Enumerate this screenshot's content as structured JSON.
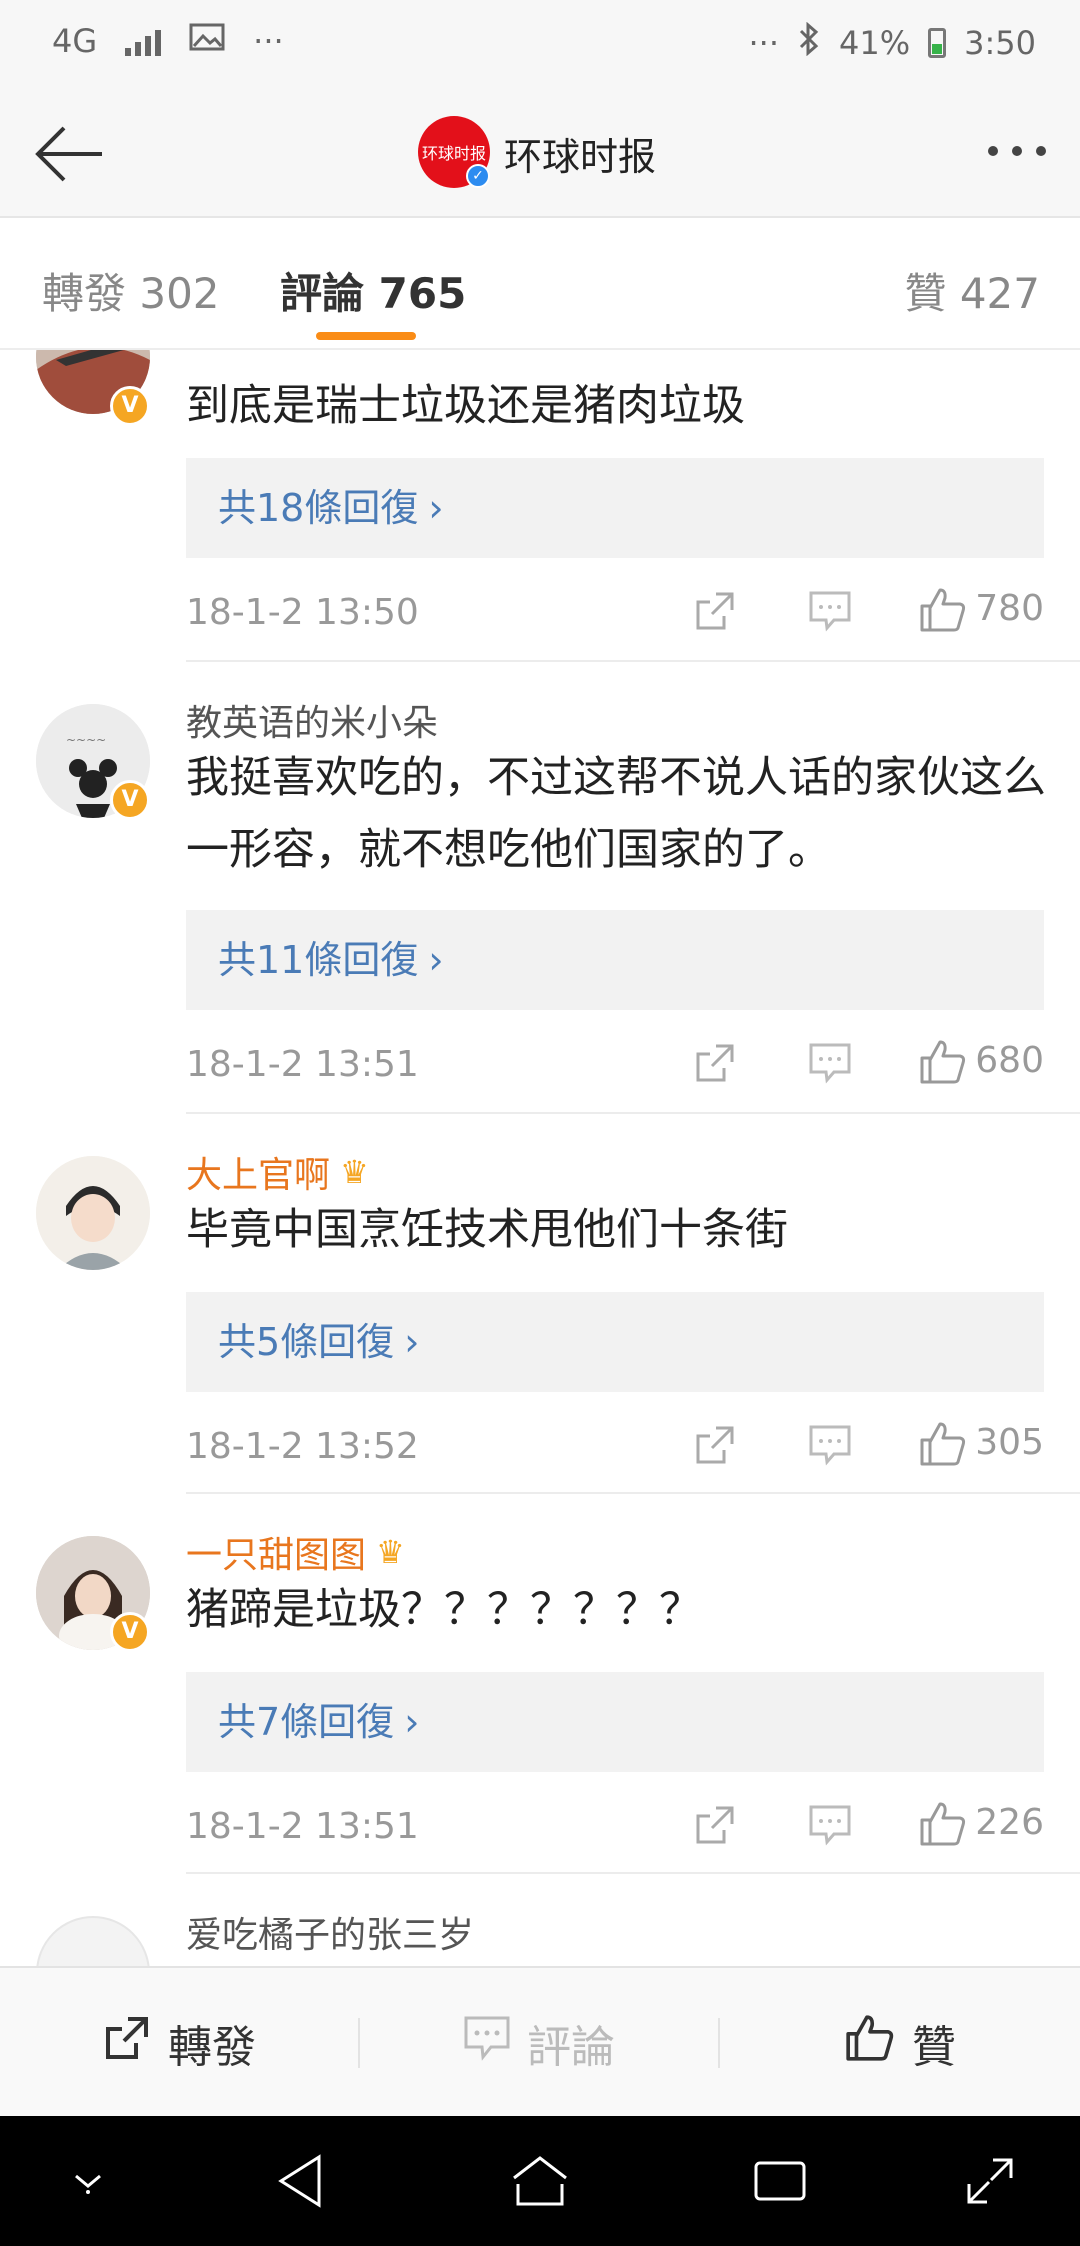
{
  "status_bar": {
    "network": "4G",
    "more_left": "···",
    "more_right": "···",
    "battery": "41%",
    "time": "3:50"
  },
  "nav": {
    "title": "环球时报",
    "logo_text": "环球时报"
  },
  "tabs": {
    "repost": "轉發 302",
    "comment": "評論 765",
    "like": "贊 427"
  },
  "comments": [
    {
      "name": "",
      "text": "到底是瑞士垃圾还是猪肉垃圾",
      "replies": "共18條回復",
      "time": "18-1-2 13:50",
      "likes": "780",
      "verified": true
    },
    {
      "name": "教英语的米小朵",
      "text": "我挺喜欢吃的，不过这帮不说人话的家伙这么一形容，就不想吃他们国家的了。",
      "replies": "共11條回復",
      "time": "18-1-2 13:51",
      "likes": "680",
      "verified": true
    },
    {
      "name": "大上官啊",
      "text": "毕竟中国烹饪技术甩他们十条街",
      "replies": "共5條回復",
      "time": "18-1-2 13:52",
      "likes": "305",
      "verified": false
    },
    {
      "name": "一只甜图图",
      "text": "猪蹄是垃圾？？？？？？？",
      "replies": "共7條回復",
      "time": "18-1-2 13:51",
      "likes": "226",
      "verified": true
    },
    {
      "name": "爱吃橘子的张三岁"
    }
  ],
  "action_bar": {
    "repost": "轉發",
    "comment": "評論",
    "like": "贊"
  },
  "colors": {
    "accent": "#fa8c16",
    "link": "#4a7bb6",
    "vip_name": "#e8761e",
    "verified_badge": "#f5a623"
  }
}
